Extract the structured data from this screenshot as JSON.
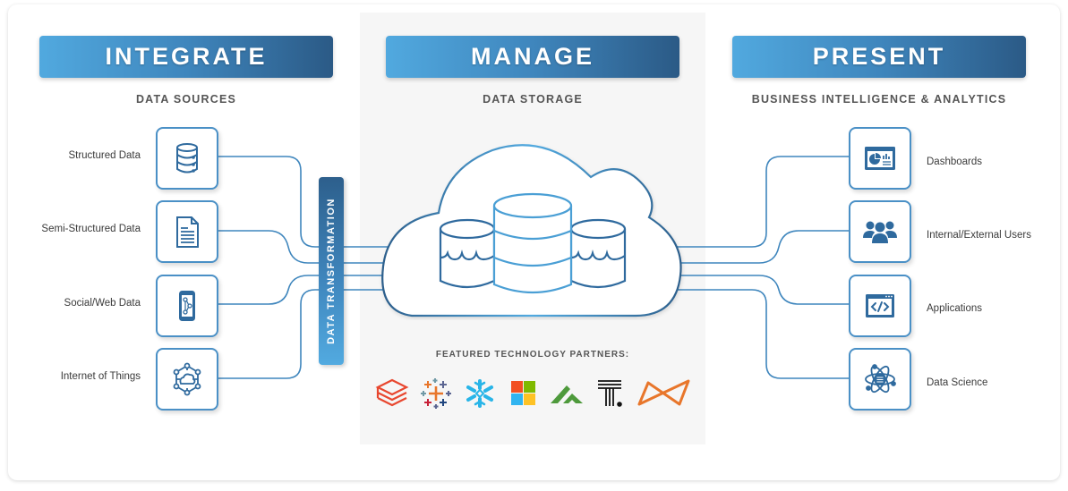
{
  "columns": {
    "integrate": {
      "title": "INTEGRATE",
      "subtitle": "DATA SOURCES",
      "items": [
        {
          "label": "Structured Data",
          "icon": "database-icon"
        },
        {
          "label": "Semi-Structured Data",
          "icon": "document-icon"
        },
        {
          "label": "Social/Web Data",
          "icon": "mobile-share-icon"
        },
        {
          "label": "Internet of Things",
          "icon": "iot-network-icon"
        }
      ]
    },
    "manage": {
      "title": "MANAGE",
      "subtitle": "DATA STORAGE",
      "transform_label": "DATA TRANSFORMATION",
      "partners_title": "FEATURED TECHNOLOGY PARTNERS:",
      "partners": [
        {
          "name": "databricks-logo",
          "color": "#e8472f"
        },
        {
          "name": "tableau-logo",
          "color": "#e8762b"
        },
        {
          "name": "snowflake-logo",
          "color": "#29b5e8"
        },
        {
          "name": "microsoft-logo",
          "color": "#f25022"
        },
        {
          "name": "green-peaks-logo",
          "color": "#4e9a3c"
        },
        {
          "name": "t-dot-logo",
          "color": "#111111"
        },
        {
          "name": "orange-bowtie-logo",
          "color": "#e8762b"
        }
      ]
    },
    "present": {
      "title": "PRESENT",
      "subtitle": "BUSINESS INTELLIGENCE & ANALYTICS",
      "items": [
        {
          "label": "Dashboards",
          "icon": "dashboard-icon"
        },
        {
          "label": "Internal/External Users",
          "icon": "users-icon"
        },
        {
          "label": "Applications",
          "icon": "code-window-icon"
        },
        {
          "label": "Data Science",
          "icon": "atom-database-icon"
        }
      ]
    }
  },
  "colors": {
    "banner_start": "#51a9df",
    "banner_end": "#2b5a86",
    "line": "#3f86bd",
    "icon": "#2f6a9e"
  }
}
